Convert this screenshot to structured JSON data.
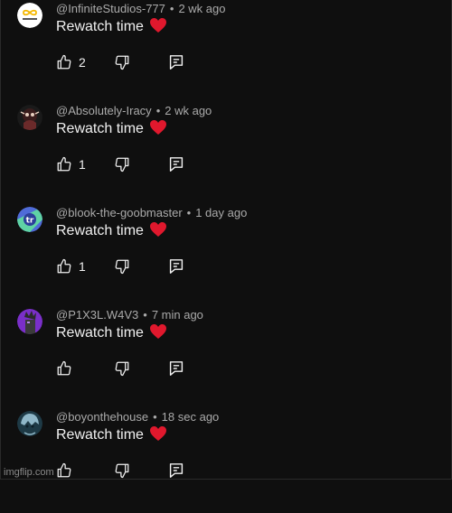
{
  "comments": [
    {
      "handle": "@InfiniteStudios-777",
      "time": "2 wk ago",
      "text": "Rewatch time",
      "emoji": "❤️",
      "likes": "2",
      "avatar": "infinity-logo",
      "avatar_colors": [
        "#ffffff",
        "#f5b800"
      ]
    },
    {
      "handle": "@Absolutely-Iracy",
      "time": "2 wk ago",
      "text": "Rewatch time",
      "emoji": "❤️",
      "likes": "1",
      "avatar": "dark-character",
      "avatar_colors": [
        "#3a1c1c",
        "#e8d0c0"
      ]
    },
    {
      "handle": "@blook-the-goobmaster",
      "time": "1 day ago",
      "text": "Rewatch time",
      "emoji": "❤️",
      "likes": "1",
      "avatar": "blue-green-logo",
      "avatar_colors": [
        "#4f6bd8",
        "#5fd3a5"
      ]
    },
    {
      "handle": "@P1X3L.W4V3",
      "time": "7 min ago",
      "text": "Rewatch time",
      "emoji": "❤️",
      "likes": "",
      "avatar": "purple-character",
      "avatar_colors": [
        "#7a2fc9",
        "#2a2a2a"
      ]
    },
    {
      "handle": "@boyonthehouse",
      "time": "18 sec ago",
      "text": "Rewatch time",
      "emoji": "❤️",
      "likes": "",
      "avatar": "anime-character",
      "avatar_colors": [
        "#1e3a46",
        "#8fb7c8"
      ]
    }
  ],
  "icons": {
    "like": "thumbs-up-icon",
    "dislike": "thumbs-down-icon",
    "reply": "reply-icon",
    "heart": "red-heart-emoji"
  },
  "colors": {
    "background": "#0f0f0f",
    "text": "#f1f1f1",
    "meta": "#aaaaaa",
    "heart": "#e0182d"
  },
  "watermark": "imgflip.com"
}
